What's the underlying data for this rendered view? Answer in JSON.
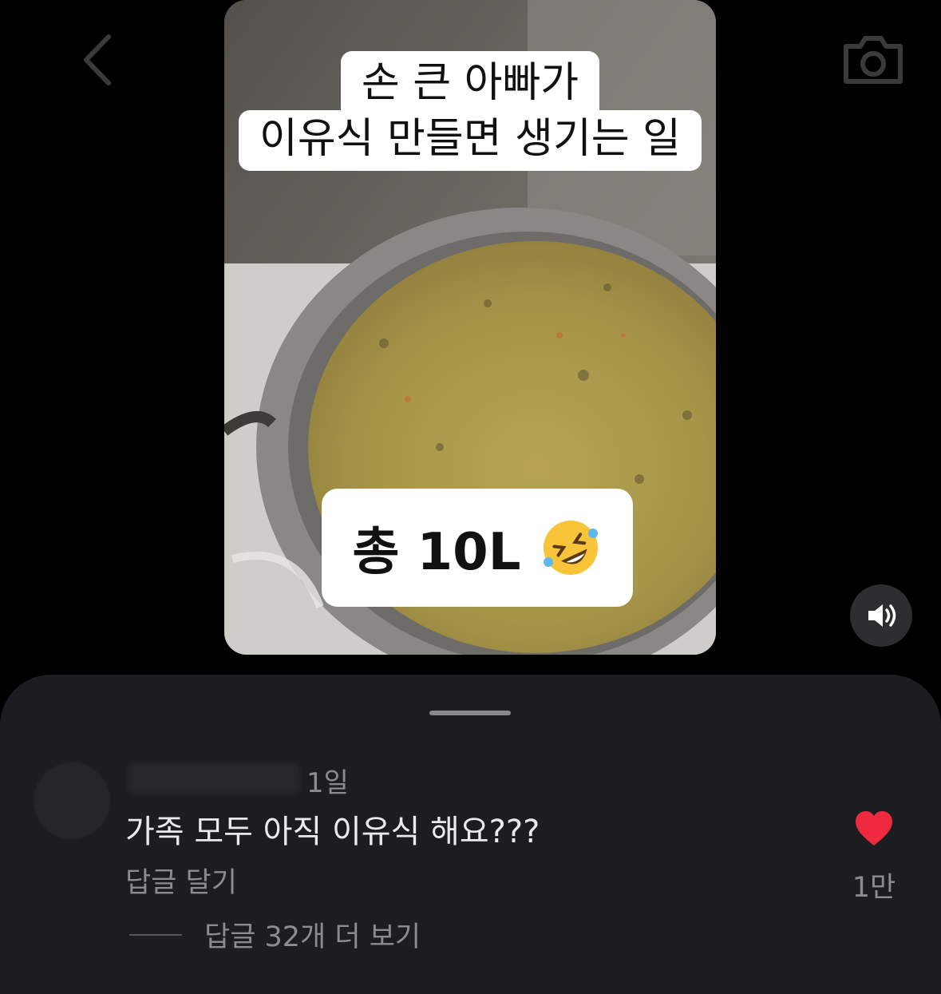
{
  "nav": {
    "back_icon": "chevron-left-icon",
    "camera_icon": "camera-icon"
  },
  "media": {
    "caption_line1": "손 큰 아빠가",
    "caption_line2": "이유식 만들면 생기는 일",
    "caption_bottom": "총 10L",
    "emoji": "rolling-on-floor-laughing-icon"
  },
  "mute_icon": "speaker-icon",
  "comment": {
    "time": "1일",
    "text": "가족 모두 아직 이유식 해요???",
    "reply_label": "답글 달기",
    "like_count": "1만",
    "more_replies": "답글 32개 더 보기"
  },
  "colors": {
    "sheet_bg": "#1b1d21",
    "like_red": "#ef2a3f",
    "muted_text": "#8a8c90"
  }
}
